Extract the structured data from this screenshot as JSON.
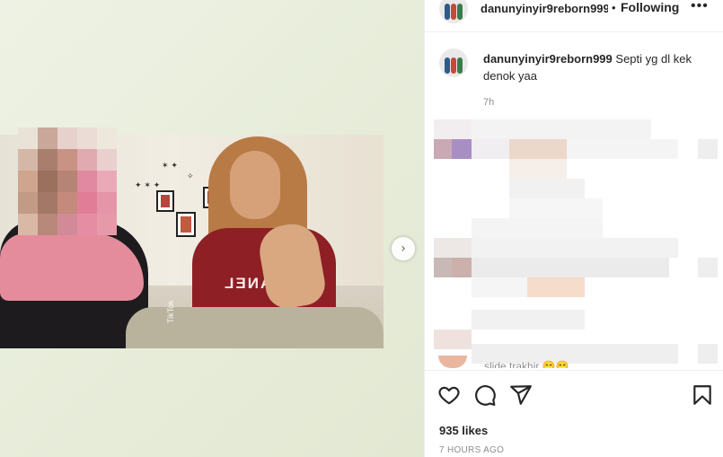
{
  "post": {
    "username": "danunyinyir9reborn999",
    "separator": "•",
    "follow_label": "Following",
    "more_icon": "more-horizontal-icon",
    "caption_text": "Septi yg dl kek denok yaa",
    "caption_time": "7h",
    "partial_comment": "slide trakhir 😁😁",
    "likes": "935 likes",
    "posted_ago": "7 HOURS AGO"
  },
  "media": {
    "watermark": "TikTok",
    "shirt_text": "CHANEL",
    "next_icon": "chevron-right-icon"
  },
  "actions": {
    "like_icon": "heart-icon",
    "comment_icon": "comment-icon",
    "share_icon": "share-icon",
    "save_icon": "bookmark-icon"
  },
  "colors": {
    "text": "#262626",
    "secondary": "#8e8e8e",
    "border": "#efefef",
    "shirt": "#8d1f25"
  }
}
